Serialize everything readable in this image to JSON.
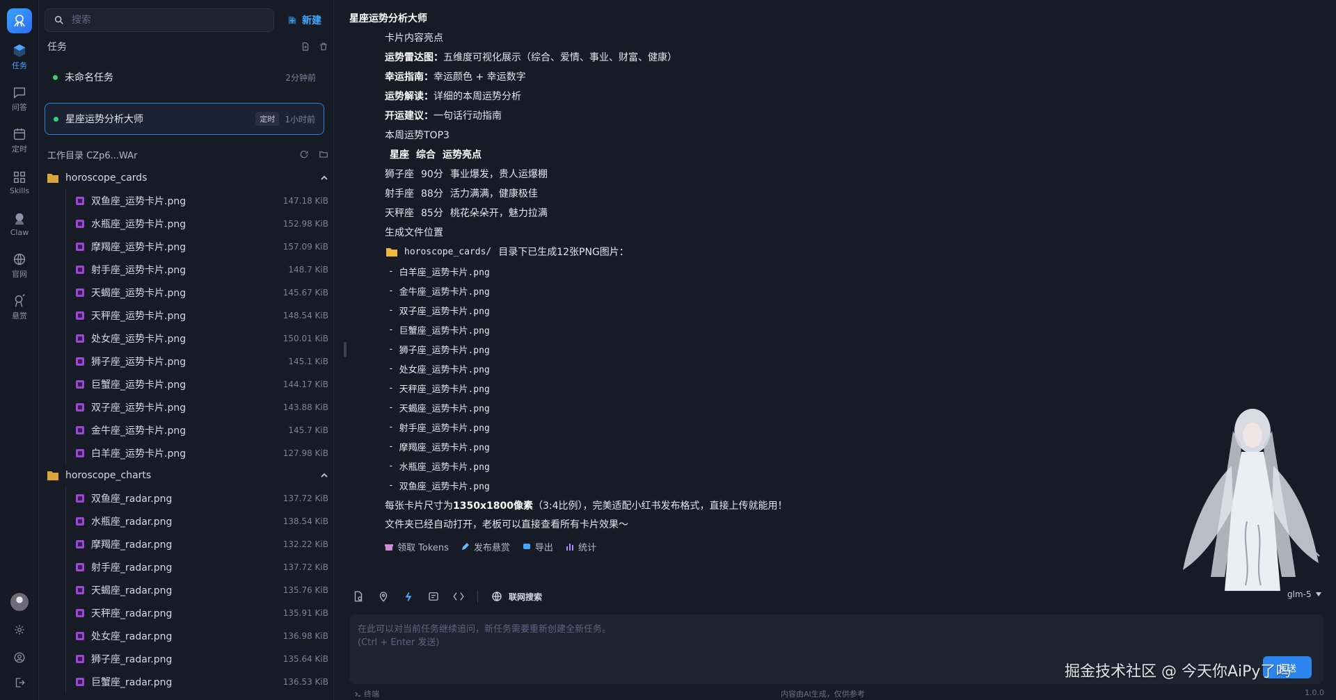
{
  "sidebar_rail": {
    "items": [
      {
        "label": "任务",
        "icon": "cube-icon"
      },
      {
        "label": "问答",
        "icon": "chat-icon"
      },
      {
        "label": "定时",
        "icon": "calendar-icon"
      },
      {
        "label": "Skills",
        "icon": "grid-icon"
      },
      {
        "label": "Claw",
        "icon": "octopus-icon"
      },
      {
        "label": "官网",
        "icon": "globe-icon"
      },
      {
        "label": "悬赏",
        "icon": "bounty-icon"
      }
    ]
  },
  "search": {
    "placeholder": "搜索"
  },
  "new_button": {
    "label": "新建"
  },
  "tasks_section": {
    "title": "任务"
  },
  "tasks": [
    {
      "name": "未命名任务",
      "time": "2分钟前"
    },
    {
      "name": "星座运势分析大师",
      "badge": "定时",
      "time": "1小时前"
    }
  ],
  "workdir": {
    "label": "工作目录 CZp6...WAr"
  },
  "folders": [
    {
      "name": "horoscope_cards",
      "files": [
        {
          "name": "双鱼座_运势卡片.png",
          "size": "147.18 KiB"
        },
        {
          "name": "水瓶座_运势卡片.png",
          "size": "152.98 KiB"
        },
        {
          "name": "摩羯座_运势卡片.png",
          "size": "157.09 KiB"
        },
        {
          "name": "射手座_运势卡片.png",
          "size": "148.7 KiB"
        },
        {
          "name": "天蝎座_运势卡片.png",
          "size": "145.67 KiB"
        },
        {
          "name": "天秤座_运势卡片.png",
          "size": "148.54 KiB"
        },
        {
          "name": "处女座_运势卡片.png",
          "size": "150.01 KiB"
        },
        {
          "name": "狮子座_运势卡片.png",
          "size": "145.1 KiB"
        },
        {
          "name": "巨蟹座_运势卡片.png",
          "size": "144.17 KiB"
        },
        {
          "name": "双子座_运势卡片.png",
          "size": "143.88 KiB"
        },
        {
          "name": "金牛座_运势卡片.png",
          "size": "145.7 KiB"
        },
        {
          "name": "白羊座_运势卡片.png",
          "size": "127.98 KiB"
        }
      ]
    },
    {
      "name": "horoscope_charts",
      "files": [
        {
          "name": "双鱼座_radar.png",
          "size": "137.72 KiB"
        },
        {
          "name": "水瓶座_radar.png",
          "size": "138.54 KiB"
        },
        {
          "name": "摩羯座_radar.png",
          "size": "132.22 KiB"
        },
        {
          "name": "射手座_radar.png",
          "size": "137.72 KiB"
        },
        {
          "name": "天蝎座_radar.png",
          "size": "135.76 KiB"
        },
        {
          "name": "天秤座_radar.png",
          "size": "135.91 KiB"
        },
        {
          "name": "处女座_radar.png",
          "size": "136.98 KiB"
        },
        {
          "name": "狮子座_radar.png",
          "size": "135.64 KiB"
        },
        {
          "name": "巨蟹座_radar.png",
          "size": "136.53 KiB"
        }
      ]
    }
  ],
  "chat": {
    "title": "星座运势分析大师",
    "highlights_heading": "卡片内容亮点",
    "highlights": [
      {
        "k": "运势雷达图：",
        "v": "五维度可视化展示（综合、爱情、事业、财富、健康）"
      },
      {
        "k": "幸运指南：",
        "v": "幸运颜色 + 幸运数字"
      },
      {
        "k": "运势解读：",
        "v": "详细的本周运势分析"
      },
      {
        "k": "开运建议：",
        "v": "一句话行动指南"
      }
    ],
    "top3_heading": "本周运势TOP3",
    "top3_header": {
      "c1": "星座",
      "c2": "综合",
      "c3": "运势亮点"
    },
    "top3": [
      {
        "sign": "狮子座",
        "score": "90分",
        "note": "事业爆发，贵人运爆棚"
      },
      {
        "sign": "射手座",
        "score": "88分",
        "note": "活力满满，健康极佳"
      },
      {
        "sign": "天秤座",
        "score": "85分",
        "note": "桃花朵朵开，魅力拉满"
      }
    ],
    "location_heading": "生成文件位置",
    "location_dir": "horoscope_cards/",
    "location_text": "目录下已生成12张PNG图片：",
    "generated_files": [
      "白羊座_运势卡片.png",
      "金牛座_运势卡片.png",
      "双子座_运势卡片.png",
      "巨蟹座_运势卡片.png",
      "狮子座_运势卡片.png",
      "处女座_运势卡片.png",
      "天秤座_运势卡片.png",
      "天蝎座_运势卡片.png",
      "射手座_运势卡片.png",
      "摩羯座_运势卡片.png",
      "水瓶座_运势卡片.png",
      "双鱼座_运势卡片.png"
    ],
    "size_pre": "每张卡片尺寸为 ",
    "size_bold": "1350x1800像素",
    "size_post": "（3:4比例），完美适配小红书发布格式，直接上传就能用！",
    "closing": "文件夹已经自动打开，老板可以直接查看所有卡片效果～",
    "actions": [
      {
        "label": "领取 Tokens",
        "icon": "gift-icon",
        "color": "#d08ad6"
      },
      {
        "label": "发布悬赏",
        "icon": "pen-icon",
        "color": "#6fb7ff"
      },
      {
        "label": "导出",
        "icon": "export-icon",
        "color": "#41a8ff"
      },
      {
        "label": "统计",
        "icon": "bar-chart-icon",
        "color": "#b58cff"
      }
    ]
  },
  "composer": {
    "web_search": "联网搜索",
    "model": "glm-5",
    "placeholder_line1": "在此可以对当前任务继续追问，新任务需要重新创建全新任务。",
    "placeholder_line2": "(Ctrl + Enter 发送)",
    "send": "发送"
  },
  "footer": {
    "left": "终端",
    "center": "内容由AI生成，仅供参考",
    "version": "1.0.0"
  },
  "watermark": "掘金技术社区 @ 今天你AiPy了吗"
}
